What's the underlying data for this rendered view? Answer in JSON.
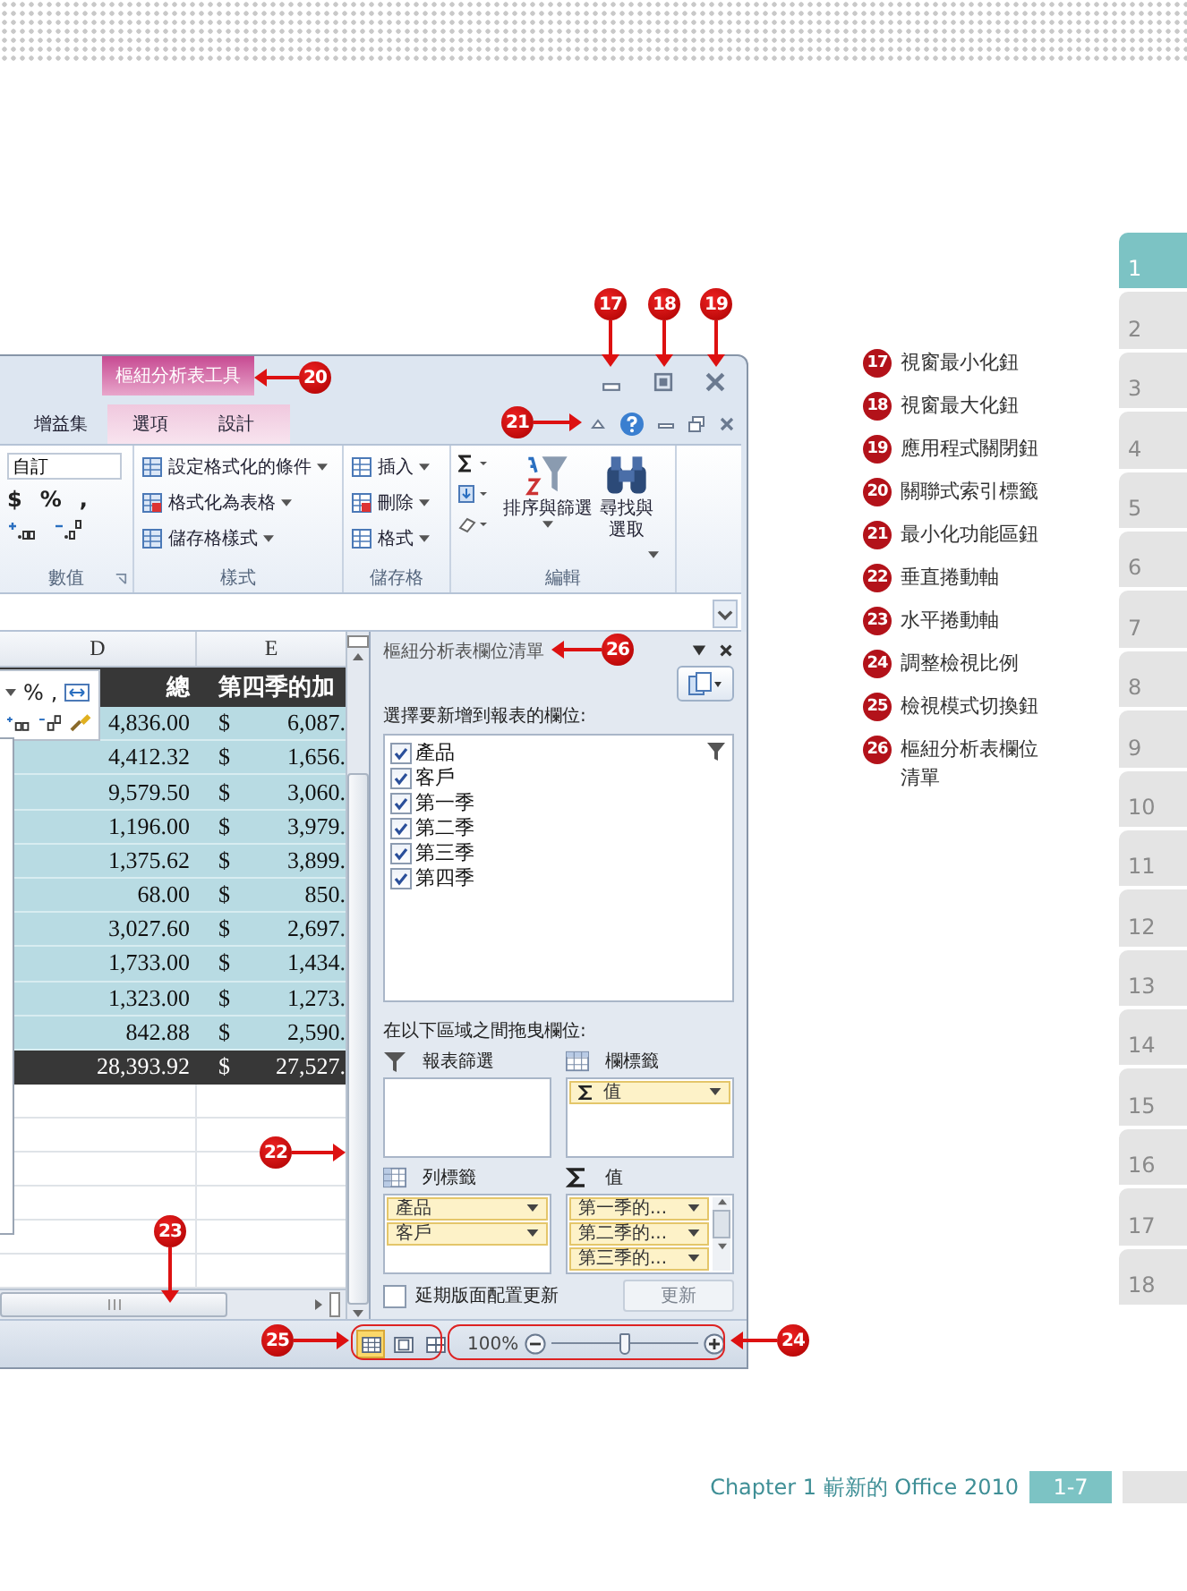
{
  "excel": {
    "contextual_group": "樞紐分析表工具",
    "tabs": [
      {
        "label": "增益集",
        "selected": false,
        "contextual": false
      },
      {
        "label": "選項",
        "selected": false,
        "contextual": true
      },
      {
        "label": "設計",
        "selected": false,
        "contextual": true
      }
    ],
    "ribbon": [
      {
        "kind": "number",
        "label": "數值",
        "format": "自訂",
        "symbols": [
          "$",
          "%",
          ","
        ]
      },
      {
        "kind": "styles",
        "label": "樣式",
        "commands": [
          "設定格式化的條件",
          "格式化為表格",
          "儲存格樣式"
        ]
      },
      {
        "kind": "cells",
        "label": "儲存格",
        "commands": [
          "插入",
          "刪除",
          "格式"
        ]
      },
      {
        "kind": "editing",
        "label": "編輯",
        "commands": [
          "排序與篩選",
          "尋找與選取"
        ]
      }
    ],
    "sheet": {
      "columns": [
        "D",
        "E"
      ],
      "header": [
        "總",
        "第四季的加"
      ],
      "rows": [
        [
          "4,836.00",
          "$",
          "6,087."
        ],
        [
          "4,412.32",
          "$",
          "1,656."
        ],
        [
          "9,579.50",
          "$",
          "3,060."
        ],
        [
          "1,196.00",
          "$",
          "3,979."
        ],
        [
          "1,375.62",
          "$",
          "3,899."
        ],
        [
          "68.00",
          "$",
          "850."
        ],
        [
          "3,027.60",
          "$",
          "2,697."
        ],
        [
          "1,733.00",
          "$",
          "1,434."
        ],
        [
          "1,323.00",
          "$",
          "1,273."
        ],
        [
          "842.88",
          "$",
          "2,590."
        ]
      ],
      "total": [
        "28,393.92",
        "$",
        "27,527."
      ]
    },
    "mini_toolbar": {
      "symbols": [
        "%",
        ","
      ]
    },
    "field_list": {
      "title": "樞紐分析表欄位清單",
      "prompt": "選擇要新增到報表的欄位:",
      "fields": [
        {
          "label": "產品",
          "checked": true
        },
        {
          "label": "客戶",
          "checked": true
        },
        {
          "label": "第一季",
          "checked": true
        },
        {
          "label": "第二季",
          "checked": true
        },
        {
          "label": "第三季",
          "checked": true
        },
        {
          "label": "第四季",
          "checked": true
        }
      ],
      "drag_prompt": "在以下區域之間拖曳欄位:",
      "areas": [
        {
          "kind": "filter",
          "title": "報表篩選"
        },
        {
          "kind": "columns",
          "title": "欄標籤",
          "items": [
            {
              "label": "值",
              "sigma": true
            }
          ]
        },
        {
          "kind": "rows",
          "title": "列標籤",
          "items": [
            {
              "label": "產品",
              "sigma": false
            },
            {
              "label": "客戶",
              "sigma": false
            }
          ]
        },
        {
          "kind": "values",
          "title": "值",
          "items": [
            {
              "label": "第一季的...",
              "sigma": false
            },
            {
              "label": "第二季的...",
              "sigma": false
            },
            {
              "label": "第三季的...",
              "sigma": false
            }
          ]
        }
      ],
      "defer_update": {
        "label": "延期版面配置更新",
        "checked": false
      },
      "update_button": {
        "label": "更新",
        "disabled": true
      }
    },
    "status_bar": {
      "views": [
        {
          "kind": "normal",
          "selected": true
        },
        {
          "kind": "page_layout",
          "selected": false
        },
        {
          "kind": "page_break",
          "selected": false
        }
      ],
      "zoom": "100%",
      "zoom_slider": {
        "level": 0.5
      }
    }
  },
  "callouts": [
    "17",
    "18",
    "19",
    "20",
    "21",
    "22",
    "23",
    "24",
    "25",
    "26"
  ],
  "legend": [
    {
      "number": "17",
      "label": "視窗最小化鈕"
    },
    {
      "number": "18",
      "label": "視窗最大化鈕"
    },
    {
      "number": "19",
      "label": "應用程式關閉鈕"
    },
    {
      "number": "20",
      "label": "關聯式索引標籤"
    },
    {
      "number": "21",
      "label": "最小化功能區鈕"
    },
    {
      "number": "22",
      "label": "垂直捲動軸"
    },
    {
      "number": "23",
      "label": "水平捲動軸"
    },
    {
      "number": "24",
      "label": "調整檢視比例"
    },
    {
      "number": "25",
      "label": "檢視模式切換鈕"
    },
    {
      "number": "26",
      "label": "樞紐分析表欄位清單"
    }
  ],
  "chapter_tabs": [
    {
      "label": "1",
      "selected": true
    },
    {
      "label": "2",
      "selected": false
    },
    {
      "label": "3",
      "selected": false
    },
    {
      "label": "4",
      "selected": false
    },
    {
      "label": "5",
      "selected": false
    },
    {
      "label": "6",
      "selected": false
    },
    {
      "label": "7",
      "selected": false
    },
    {
      "label": "8",
      "selected": false
    },
    {
      "label": "9",
      "selected": false
    },
    {
      "label": "10",
      "selected": false
    },
    {
      "label": "11",
      "selected": false
    },
    {
      "label": "12",
      "selected": false
    },
    {
      "label": "13",
      "selected": false
    },
    {
      "label": "14",
      "selected": false
    },
    {
      "label": "15",
      "selected": false
    },
    {
      "label": "16",
      "selected": false
    },
    {
      "label": "17",
      "selected": false
    },
    {
      "label": "18",
      "selected": false
    }
  ],
  "footer": {
    "chapter": "Chapter 1 嶄新的 Office 2010",
    "page": "1-7"
  }
}
